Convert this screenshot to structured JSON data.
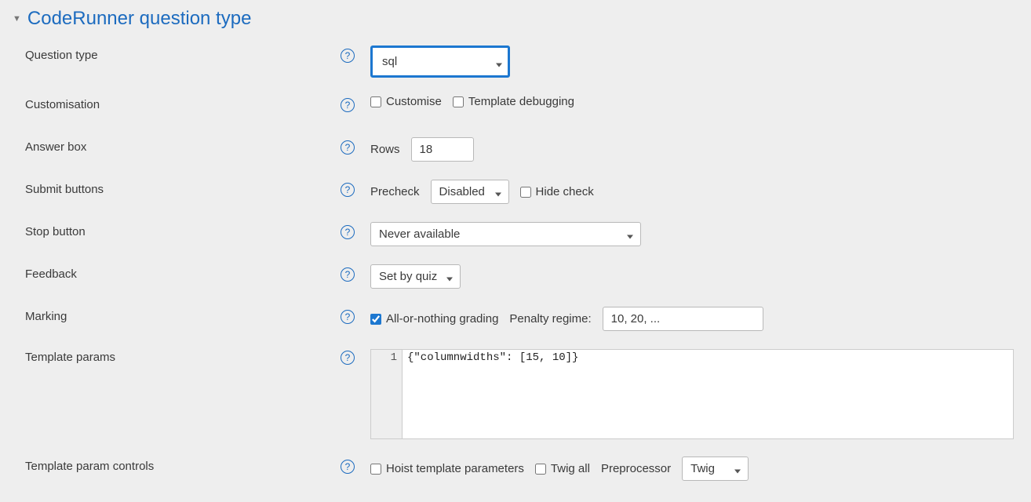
{
  "section": {
    "title": "CodeRunner question type"
  },
  "labels": {
    "question_type": "Question type",
    "customisation": "Customisation",
    "answer_box": "Answer box",
    "submit_buttons": "Submit buttons",
    "stop_button": "Stop button",
    "feedback": "Feedback",
    "marking": "Marking",
    "template_params": "Template params",
    "template_param_controls": "Template param controls"
  },
  "fields": {
    "question_type_value": "sql",
    "customise_label": "Customise",
    "template_debugging_label": "Template debugging",
    "rows_label": "Rows",
    "rows_value": "18",
    "precheck_label": "Precheck",
    "precheck_value": "Disabled",
    "hide_check_label": "Hide check",
    "stop_button_value": "Never available",
    "feedback_value": "Set by quiz",
    "all_or_nothing_label": "All-or-nothing grading",
    "penalty_regime_label": "Penalty regime:",
    "penalty_regime_value": "10, 20, ...",
    "template_params_line_number": "1",
    "template_params_code": "{\"columnwidths\": [15, 10]}",
    "hoist_label": "Hoist template parameters",
    "twig_all_label": "Twig all",
    "preprocessor_label": "Preprocessor",
    "preprocessor_value": "Twig"
  }
}
